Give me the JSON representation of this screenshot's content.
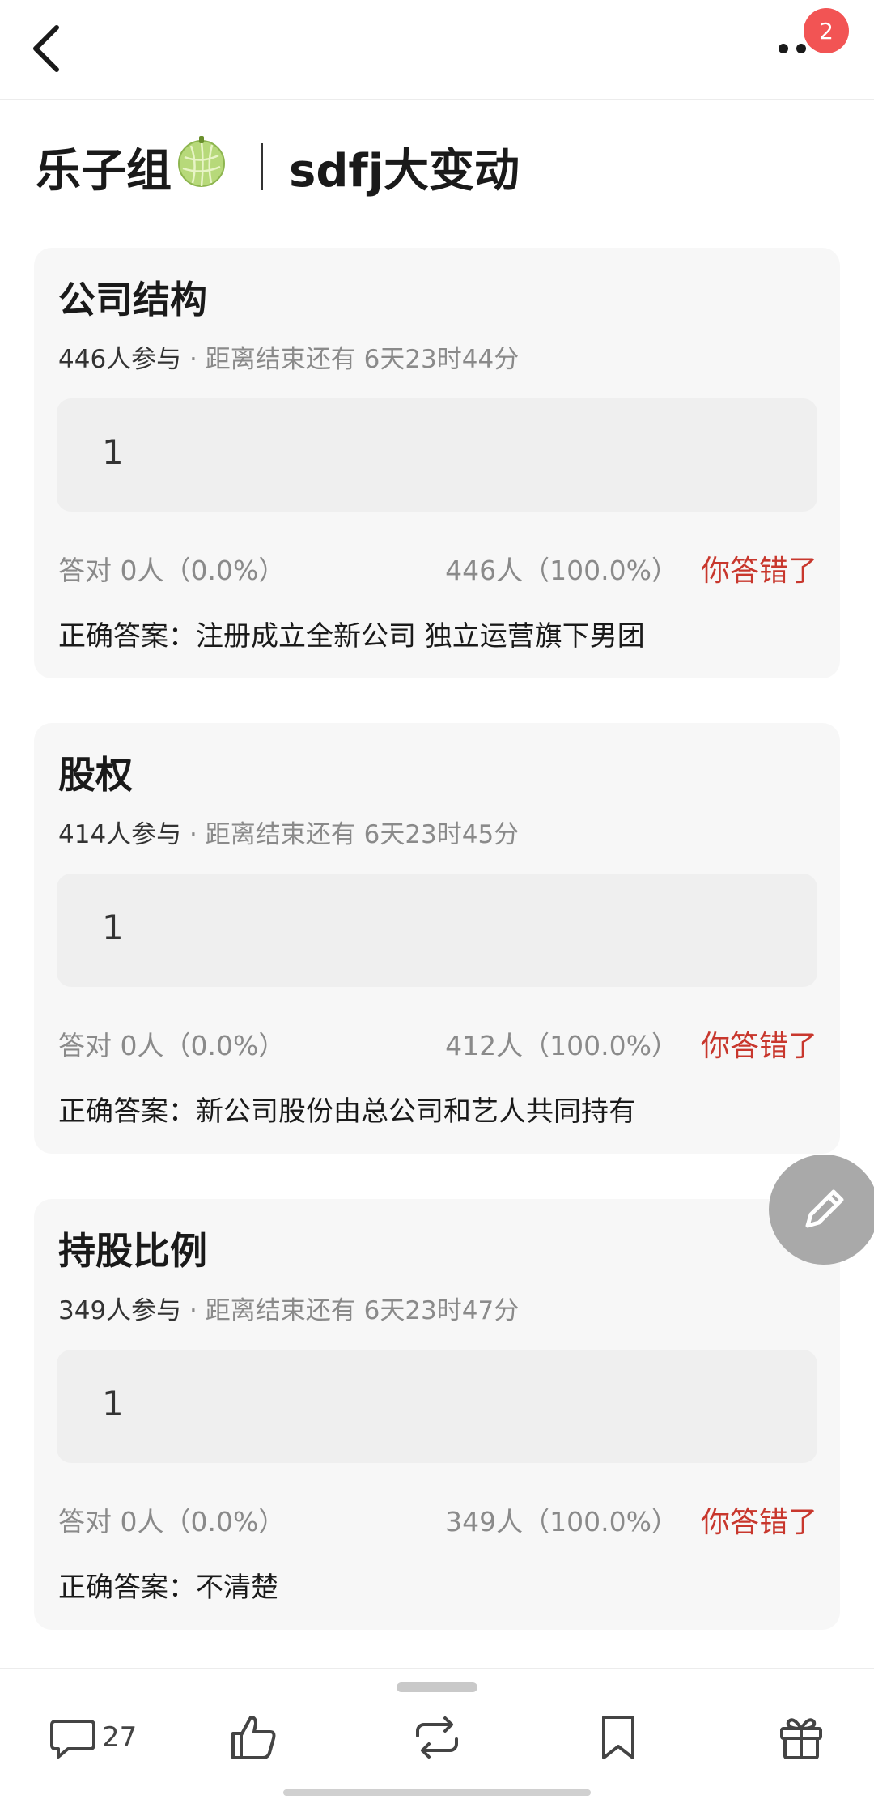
{
  "header": {
    "badge_count": "2",
    "back_icon": "chevron-left-icon",
    "more_icon": "more-dots-icon"
  },
  "page": {
    "group_name": "乐子组",
    "emoji": "🍈",
    "topic": "sdfj大变动"
  },
  "questions": [
    {
      "title": "公司结构",
      "participants": "446人参与",
      "deadline": "· 距离结束还有 6天23时44分",
      "answer": "1",
      "correct_stat": "答对  0人（0.0%）",
      "answered_stat": "446人（100.0%）",
      "result": "你答错了",
      "correct_answer": "正确答案：注册成立全新公司 独立运营旗下男团"
    },
    {
      "title": "股权",
      "participants": "414人参与",
      "deadline": "· 距离结束还有 6天23时45分",
      "answer": "1",
      "correct_stat": "答对  0人（0.0%）",
      "answered_stat": "412人（100.0%）",
      "result": "你答错了",
      "correct_answer": "正确答案：新公司股份由总公司和艺人共同持有"
    },
    {
      "title": "持股比例",
      "participants": "349人参与",
      "deadline": "· 距离结束还有 6天23时47分",
      "answer": "1",
      "correct_stat": "答对  0人（0.0%）",
      "answered_stat": "349人（100.0%）",
      "result": "你答错了",
      "correct_answer": "正确答案：不清楚"
    }
  ],
  "bottom_nav": {
    "comment_count": "27",
    "icons": [
      "comment-icon",
      "like-icon",
      "repost-icon",
      "bookmark-icon",
      "gift-icon"
    ]
  },
  "colors": {
    "accent_red": "#c8372d",
    "badge_red": "#f25454",
    "card_bg": "#f7f7f7"
  }
}
